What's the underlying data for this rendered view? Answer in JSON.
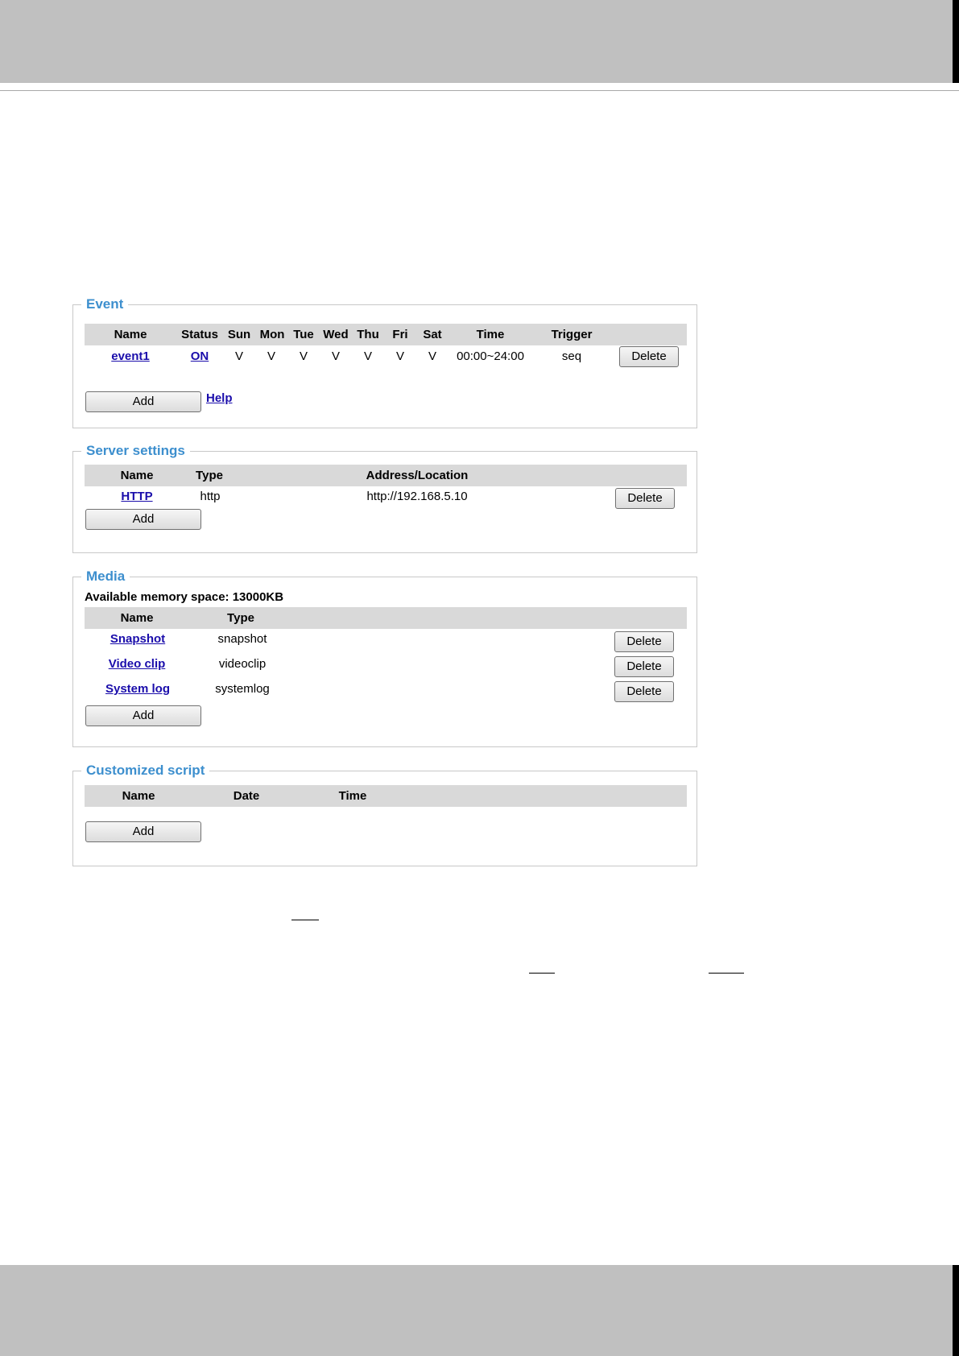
{
  "event": {
    "legend": "Event",
    "columns": [
      "Name",
      "Status",
      "Sun",
      "Mon",
      "Tue",
      "Wed",
      "Thu",
      "Fri",
      "Sat",
      "Time",
      "Trigger"
    ],
    "row": {
      "name": "event1",
      "status": "ON",
      "days": [
        "V",
        "V",
        "V",
        "V",
        "V",
        "V",
        "V"
      ],
      "time": "00:00~24:00",
      "trigger": "seq",
      "delete_label": "Delete"
    },
    "add_label": "Add",
    "help_label": "Help"
  },
  "server": {
    "legend": "Server settings",
    "columns": [
      "Name",
      "Type",
      "Address/Location"
    ],
    "row": {
      "name": "HTTP",
      "type": "http",
      "address": "http://192.168.5.10",
      "delete_label": "Delete"
    },
    "add_label": "Add"
  },
  "media": {
    "legend": "Media",
    "memory": "Available memory space: 13000KB",
    "columns": [
      "Name",
      "Type"
    ],
    "rows": [
      {
        "name": "Snapshot",
        "type": "snapshot",
        "delete_label": "Delete"
      },
      {
        "name": "Video clip",
        "type": "videoclip",
        "delete_label": "Delete"
      },
      {
        "name": "System log",
        "type": "systemlog",
        "delete_label": "Delete"
      }
    ],
    "add_label": "Add"
  },
  "script": {
    "legend": "Customized script",
    "columns": [
      "Name",
      "Date",
      "Time"
    ],
    "add_label": "Add"
  }
}
